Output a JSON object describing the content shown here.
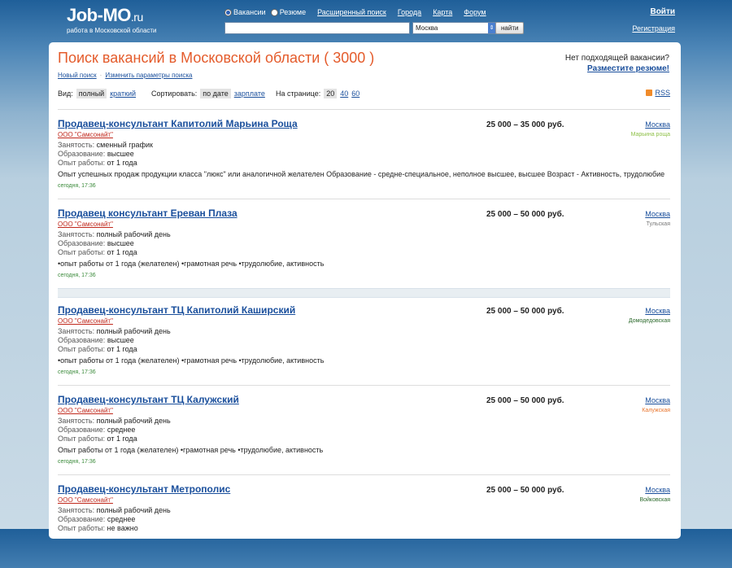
{
  "header": {
    "logo": "Job-MO",
    "logo_suffix": ".ru",
    "tagline": "работа в Московской области",
    "radio_vacancies": "Вакансии",
    "radio_resumes": "Резюме",
    "nav": [
      "Расширенный поиск",
      "Города",
      "Карта",
      "Форум"
    ],
    "search_placeholder": "",
    "region": "Москва",
    "find_button": "найти",
    "login": "Войти",
    "register": "Регистрация"
  },
  "main": {
    "title": "Поиск вакансий в Московской области ( 3000 )",
    "no_vacancy": "Нет подходящей вакансии?",
    "post_resume": "Разместите резюме!",
    "new_search": "Новый поиск",
    "change_params": "Изменить параметры поиска",
    "view_label": "Вид:",
    "view_full": "полный",
    "view_short": "краткий",
    "sort_label": "Сортировать:",
    "sort_date": "по дате",
    "sort_salary": "зарплате",
    "per_page_label": "На странице:",
    "per_page": [
      "20",
      "40",
      "60"
    ],
    "rss": "RSS"
  },
  "labels": {
    "employment": "Занятость:",
    "education": "Образование:",
    "experience": "Опыт работы:"
  },
  "jobs": [
    {
      "title": "Продавец-консультант Капитолий Марьина Роща",
      "company": "ООО \"Самсонайт\"",
      "employment": "сменный график",
      "education": "высшее",
      "experience": "от 1 года",
      "description": "Опыт успешных продаж продукции класса \"люкс\" или аналогичной желателен Образование - средне-специальное, неполное высшее, высшее Возраст - Активность, трудолюбие",
      "date": "сегодня, 17:36",
      "salary": "25 000 – 35 000 руб.",
      "city": "Москва",
      "metro": "Марьина роща",
      "metro_color": "#8fc14a"
    },
    {
      "title": "Продавец консультант Ереван Плаза",
      "company": "ООО \"Самсонайт\"",
      "employment": "полный рабочий день",
      "education": "высшее",
      "experience": "от 1 года",
      "description": "•опыт работы от 1 года (желателен) •грамотная речь •трудолюбие, активность",
      "date": "сегодня, 17:36",
      "salary": "25 000 – 50 000 руб.",
      "city": "Москва",
      "metro": "Тульская",
      "metro_color": "#777777"
    },
    {
      "title": "Продавец-консультант ТЦ Капитолий Каширский",
      "company": "ООО \"Самсонайт\"",
      "employment": "полный рабочий день",
      "education": "высшее",
      "experience": "от 1 года",
      "description": "•опыт работы от 1 года (желателен) •грамотная речь •трудолюбие, активность",
      "date": "сегодня, 17:36",
      "salary": "25 000 – 50 000 руб.",
      "city": "Москва",
      "metro": "Домодедовская",
      "metro_color": "#2e6b2e"
    },
    {
      "title": "Продавец-консультант ТЦ Калужский",
      "company": "ООО \"Самсонайт\"",
      "employment": "полный рабочий день",
      "education": "среднее",
      "experience": "от 1 года",
      "description": "Опыт работы от 1 года (желателен) •грамотная речь •трудолюбие, активность",
      "date": "сегодня, 17:36",
      "salary": "25 000 – 50 000 руб.",
      "city": "Москва",
      "metro": "Калужская",
      "metro_color": "#e8732a"
    },
    {
      "title": "Продавец-консультант Метрополис",
      "company": "ООО \"Самсонайт\"",
      "employment": "полный рабочий день",
      "education": "среднее",
      "experience": "не важно",
      "description": "",
      "date": "",
      "salary": "25 000 – 50 000 руб.",
      "city": "Москва",
      "metro": "Войковская",
      "metro_color": "#2e6b2e"
    }
  ]
}
